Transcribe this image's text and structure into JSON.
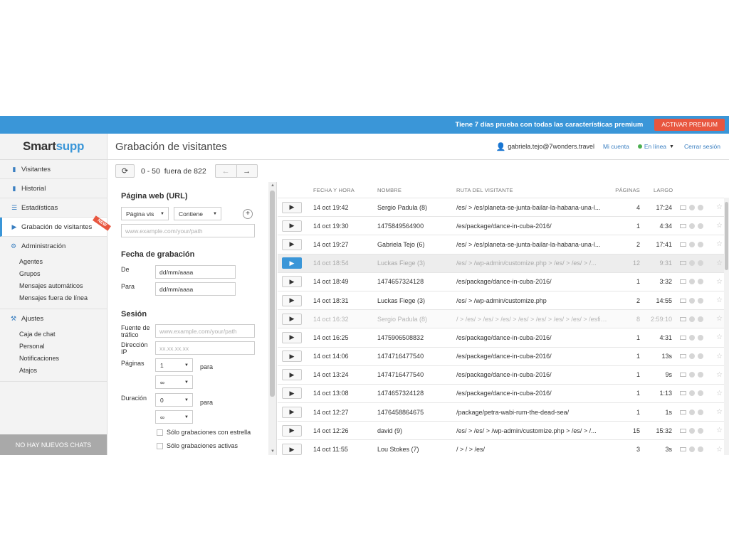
{
  "topbar": {
    "promo": "Tiene 7 días prueba con todas las características premium",
    "premium_button": "ACTIVAR PREMIUM"
  },
  "logo": {
    "part1": "Smart",
    "part2": "supp"
  },
  "sidebar": {
    "items": [
      {
        "label": "Visitantes",
        "icon": "chat-icon"
      },
      {
        "label": "Historial",
        "icon": "book-icon"
      },
      {
        "label": "Estadísticas",
        "icon": "list-icon"
      },
      {
        "label": "Grabación de visitantes",
        "icon": "play-icon",
        "badge": "NEW"
      }
    ],
    "admin": {
      "label": "Administración",
      "icon": "gear-icon",
      "subitems": [
        "Agentes",
        "Grupos",
        "Mensajes automáticos",
        "Mensajes fuera de línea"
      ]
    },
    "ajustes": {
      "label": "Ajustes",
      "icon": "wrench-icon",
      "subitems": [
        "Caja de chat",
        "Personal",
        "Notificaciones",
        "Atajos"
      ]
    },
    "no_chats": "NO HAY NUEVOS CHATS"
  },
  "header": {
    "title": "Grabación de visitantes",
    "user": "gabriela.tejo@7wonders.travel",
    "account": "Mi cuenta",
    "status": "En línea",
    "logout": "Cerrar sesión"
  },
  "toolbar": {
    "range": "0 - 50",
    "of_total": "fuera de 822",
    "prev": "←",
    "next": "→",
    "refresh": "⟳"
  },
  "filters": {
    "web_title": "Página web (URL)",
    "page_select": "Página vis",
    "contains_select": "Contiene",
    "url_placeholder": "www.example.com/your/path",
    "date_title": "Fecha de grabación",
    "from_label": "De",
    "from_value": "dd/mm/aaaa",
    "to_label": "Para",
    "to_value": "dd/mm/aaaa",
    "session_title": "Sesión",
    "source_label1": "Fuente de",
    "source_label2": "tráfico",
    "source_placeholder": "www.example.com/your/path",
    "ip_label1": "Dirección",
    "ip_label2": "IP",
    "ip_placeholder": "xx.xx.xx.xx",
    "pages_label": "Páginas",
    "pages_from": "1",
    "pages_to_label": "para",
    "pages_to": "∞",
    "duration_label": "Duración",
    "duration_from": "0",
    "duration_to_label": "para",
    "duration_to": "∞",
    "starred_only": "Sólo grabaciones con estrella",
    "active_only": "Sólo grabaciones activas"
  },
  "table": {
    "headers": {
      "date": "FECHA Y HORA",
      "name": "NOMBRE",
      "path": "RUTA DEL VISITANTE",
      "pages": "PÁGINAS",
      "duration": "LARGO"
    },
    "rows": [
      {
        "date": "14 oct 19:42",
        "name": "Sergio Padula (8)",
        "path": "/es/ > /es/planeta-se-junta-bailar-la-habana-una-l...",
        "pages": "4",
        "duration": "17:24",
        "state": "normal"
      },
      {
        "date": "14 oct 19:30",
        "name": "1475849564900",
        "path": "/es/package/dance-in-cuba-2016/",
        "pages": "1",
        "duration": "4:34",
        "state": "normal"
      },
      {
        "date": "14 oct 19:27",
        "name": "Gabriela Tejo (6)",
        "path": "/es/ > /es/planeta-se-junta-bailar-la-habana-una-l...",
        "pages": "2",
        "duration": "17:41",
        "state": "normal"
      },
      {
        "date": "14 oct 18:54",
        "name": "Luckas Fiege (3)",
        "path": "/es/ > /wp-admin/customize.php > /es/ > /es/ > /...",
        "pages": "12",
        "duration": "9:31",
        "state": "highlight"
      },
      {
        "date": "14 oct 18:49",
        "name": "1474657324128",
        "path": "/es/package/dance-in-cuba-2016/",
        "pages": "1",
        "duration": "3:32",
        "state": "normal"
      },
      {
        "date": "14 oct 18:31",
        "name": "Luckas Fiege (3)",
        "path": "/es/ > /wp-admin/customize.php",
        "pages": "2",
        "duration": "14:55",
        "state": "normal"
      },
      {
        "date": "14 oct 16:32",
        "name": "Sergio Padula (8)",
        "path": "/ > /es/ > /es/ > /es/ > /es/ > /es/ > /es/ > /es/ > /esfia-...",
        "pages": "8",
        "duration": "2:59:10",
        "state": "faded"
      },
      {
        "date": "14 oct 16:25",
        "name": "1475906508832",
        "path": "/es/package/dance-in-cuba-2016/",
        "pages": "1",
        "duration": "4:31",
        "state": "normal"
      },
      {
        "date": "14 oct 14:06",
        "name": "1474716477540",
        "path": "/es/package/dance-in-cuba-2016/",
        "pages": "1",
        "duration": "13s",
        "state": "normal"
      },
      {
        "date": "14 oct 13:24",
        "name": "1474716477540",
        "path": "/es/package/dance-in-cuba-2016/",
        "pages": "1",
        "duration": "9s",
        "state": "normal"
      },
      {
        "date": "14 oct 13:08",
        "name": "1474657324128",
        "path": "/es/package/dance-in-cuba-2016/",
        "pages": "1",
        "duration": "1:13",
        "state": "normal"
      },
      {
        "date": "14 oct 12:27",
        "name": "1476458864675",
        "path": "/package/petra-wabi-rum-the-dead-sea/",
        "pages": "1",
        "duration": "1s",
        "state": "normal"
      },
      {
        "date": "14 oct 12:26",
        "name": "david (9)",
        "path": "/es/ > /es/ > /wp-admin/customize.php > /es/ > /...",
        "pages": "15",
        "duration": "15:32",
        "state": "normal"
      },
      {
        "date": "14 oct 11:55",
        "name": "Lou Stokes (7)",
        "path": "/ > / > /es/",
        "pages": "3",
        "duration": "3s",
        "state": "normal"
      }
    ]
  },
  "colors": {
    "accent": "#3a96d8",
    "premium": "#e8563f",
    "online": "#4caf50"
  }
}
